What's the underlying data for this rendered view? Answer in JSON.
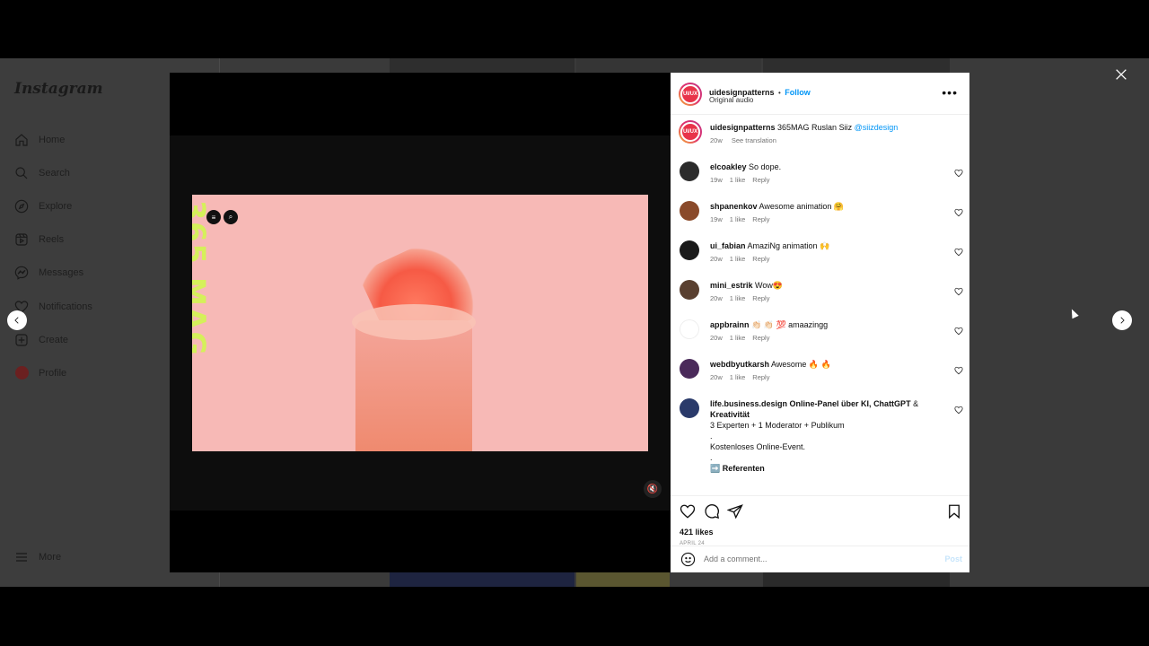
{
  "sidebar": {
    "logo": "Instagram",
    "items": [
      {
        "label": "Home",
        "icon": "home-icon"
      },
      {
        "label": "Search",
        "icon": "search-icon"
      },
      {
        "label": "Explore",
        "icon": "compass-icon"
      },
      {
        "label": "Reels",
        "icon": "reels-icon"
      },
      {
        "label": "Messages",
        "icon": "messenger-icon"
      },
      {
        "label": "Notifications",
        "icon": "heart-icon"
      },
      {
        "label": "Create",
        "icon": "plus-square-icon"
      },
      {
        "label": "Profile",
        "icon": "avatar"
      }
    ],
    "more_label": "More"
  },
  "media": {
    "overlay_text": "365 MAG",
    "mute_icon": "speaker-muted-icon"
  },
  "post": {
    "author": "uidesignpatterns",
    "avatar_text": "UI/UX",
    "separator": "•",
    "follow_label": "Follow",
    "audio": "Original audio",
    "caption_text": "365MAG Ruslan Siiz",
    "caption_mention": "@siizdesign",
    "caption_age": "20w",
    "see_translation": "See translation",
    "likes": "421 likes",
    "date": "APRIL 24",
    "add_comment_placeholder": "Add a comment...",
    "post_label": "Post"
  },
  "comments": [
    {
      "user": "elcoakley",
      "text": "So dope.",
      "age": "19w",
      "likes": "1 like",
      "reply": "Reply"
    },
    {
      "user": "shpanenkov",
      "text": "Awesome animation 🤗",
      "age": "19w",
      "likes": "1 like",
      "reply": "Reply"
    },
    {
      "user": "ui_fabian",
      "text": "AmaziNg animation 🙌",
      "age": "20w",
      "likes": "1 like",
      "reply": "Reply"
    },
    {
      "user": "mini_estrik",
      "text": "Wow😍",
      "age": "20w",
      "likes": "1 like",
      "reply": "Reply"
    },
    {
      "user": "appbrainn",
      "text": "👏🏻 👏🏻 💯 amaazingg",
      "age": "20w",
      "likes": "1 like",
      "reply": "Reply"
    },
    {
      "user": "webdbyutkarsh",
      "text": "Awesome 🔥 🔥",
      "age": "20w",
      "likes": "1 like",
      "reply": "Reply"
    }
  ],
  "long_comment": {
    "user": "life.business.design",
    "bold_text": "Online-Panel über KI, ChattGPT",
    "amp": "&",
    "bold_text2": "Kreativität",
    "line1": "3 Experten + 1 Moderator + Publikum",
    "dot": ".",
    "line2": "Kostenloses Online-Event.",
    "line3": "➡️ Referenten"
  },
  "colors": {
    "accent": "#0095f6",
    "frame_bg": "#f7b9b6",
    "mag_text": "#d5f05a"
  }
}
